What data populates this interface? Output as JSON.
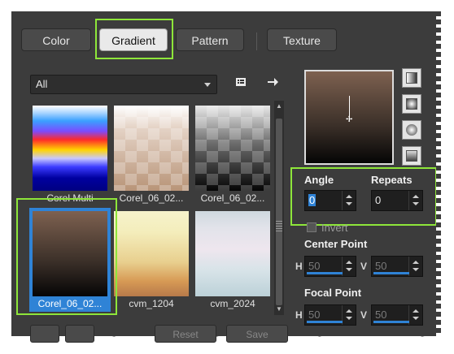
{
  "tabs": [
    {
      "label": "Color"
    },
    {
      "label": "Gradient"
    },
    {
      "label": "Pattern"
    },
    {
      "label": "Texture"
    }
  ],
  "filter": {
    "selected": "All"
  },
  "gradients": [
    {
      "label": "Corel Multi"
    },
    {
      "label": "Corel_06_02..."
    },
    {
      "label": "Corel_06_02..."
    },
    {
      "label": "Corel_06_02..."
    },
    {
      "label": "cvm_1204"
    },
    {
      "label": "cvm_2024"
    }
  ],
  "controls": {
    "angle_label": "Angle",
    "repeats_label": "Repeats",
    "angle_value": "0",
    "repeats_value": "0",
    "invert_label": "Invert",
    "center_point_label": "Center Point",
    "focal_point_label": "Focal Point",
    "h_label": "H",
    "v_label": "V",
    "center_h": "50",
    "center_v": "50",
    "focal_h": "50",
    "focal_v": "50"
  },
  "bottom": {
    "btn3": "Reset",
    "btn4": "Save"
  },
  "colors": {
    "accent": "#2f83d6",
    "highlight": "#8ee63a"
  }
}
